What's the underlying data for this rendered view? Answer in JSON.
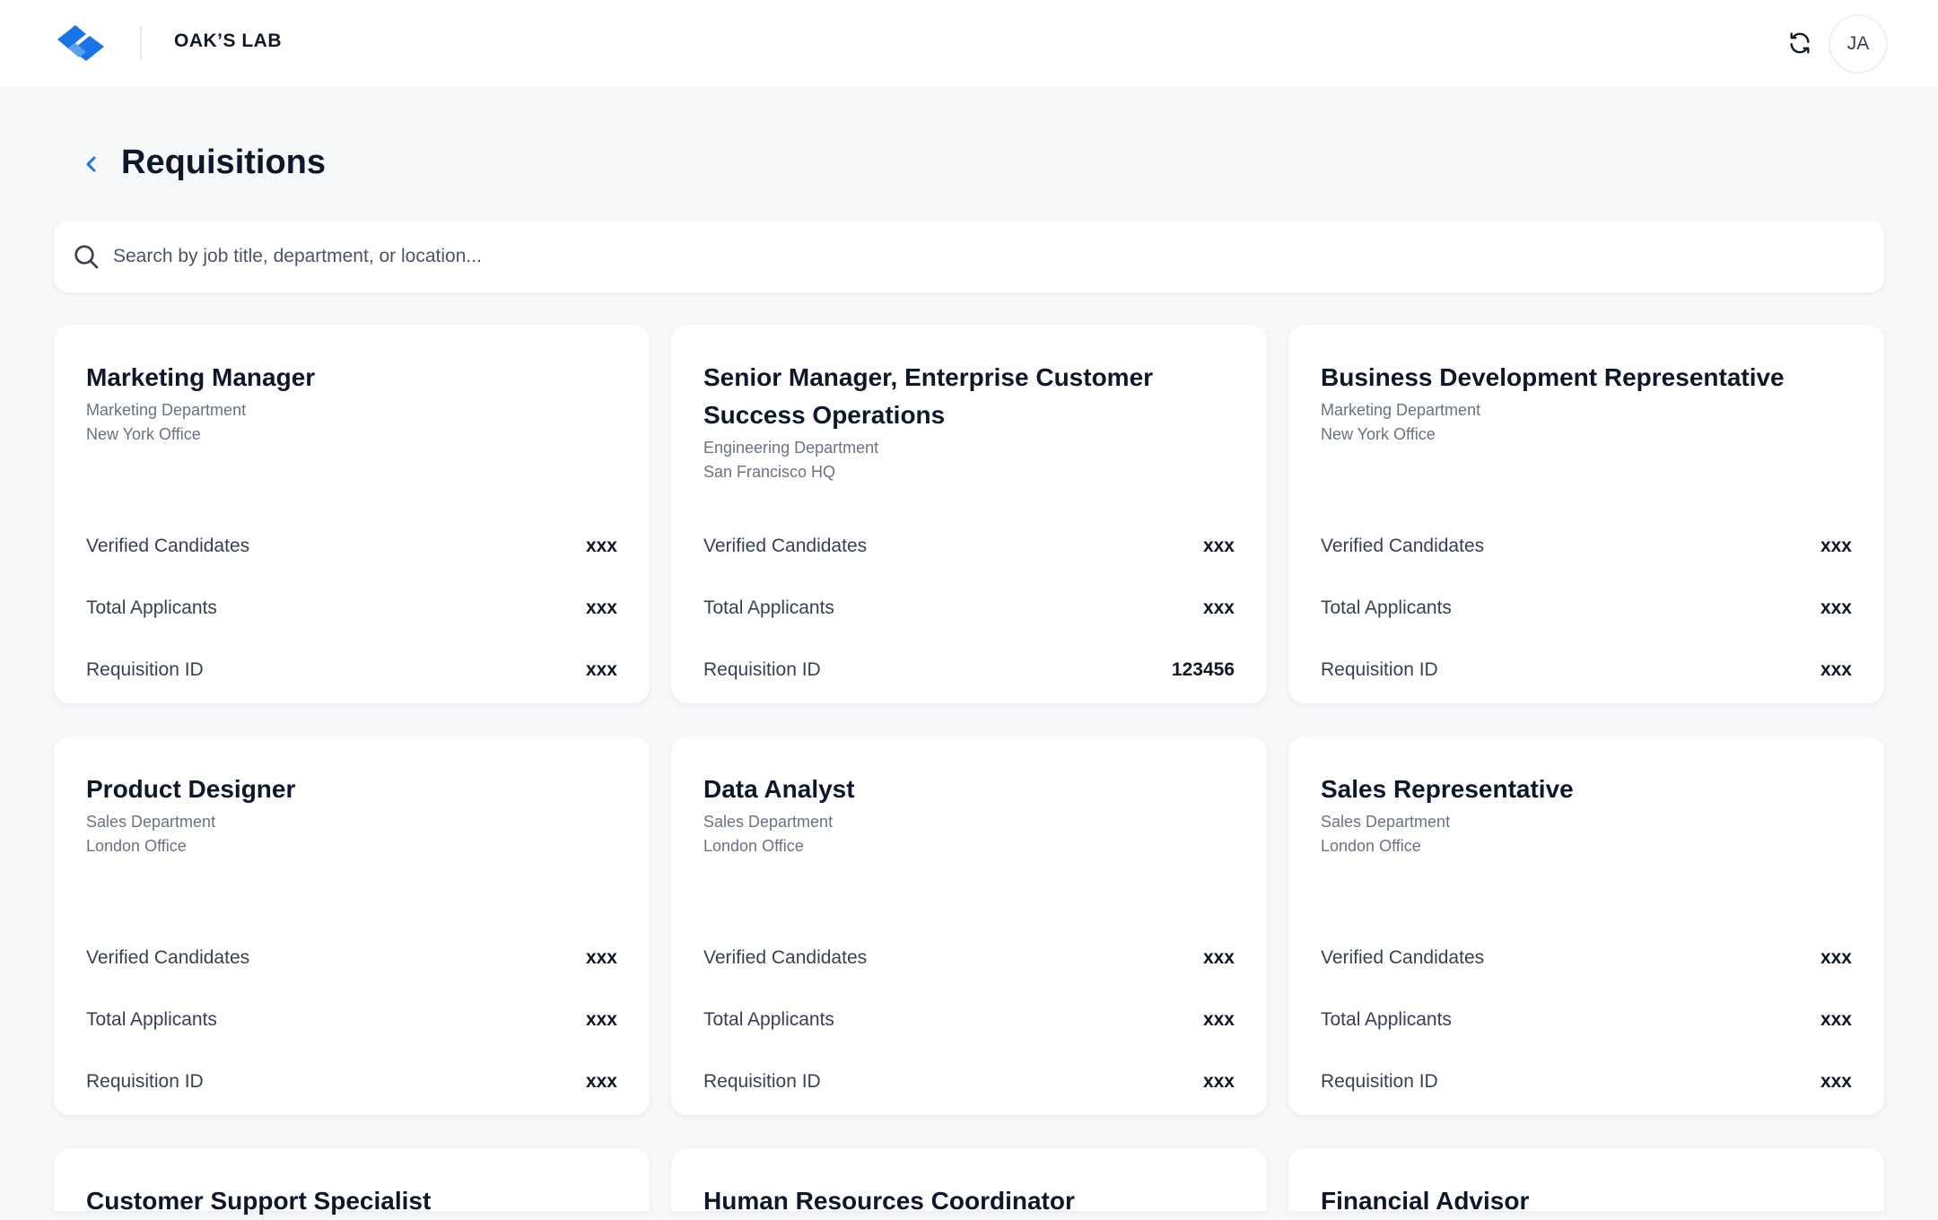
{
  "header": {
    "org_name": "OAK’S LAB",
    "avatar_initials": "JA",
    "icons": {
      "logo": "logo-mark",
      "refresh": "refresh-icon"
    },
    "brand_color": "#1a73e8"
  },
  "page": {
    "title": "Requisitions"
  },
  "search": {
    "placeholder": "Search by job title, department, or location..."
  },
  "labels": {
    "verified": "Verified Candidates",
    "total": "Total Applicants",
    "req_id": "Requisition ID"
  },
  "cards": [
    {
      "title": "Marketing Manager",
      "department": "Marketing Department",
      "location": "New York Office",
      "verified": "xxx",
      "total": "xxx",
      "req_id": "xxx"
    },
    {
      "title": "Senior Manager, Enterprise Customer Success Operations",
      "department": "Engineering Department",
      "location": "San Francisco HQ",
      "verified": "xxx",
      "total": "xxx",
      "req_id": "123456"
    },
    {
      "title": "Business Development Representative",
      "department": "Marketing Department",
      "location": "New York Office",
      "verified": "xxx",
      "total": "xxx",
      "req_id": "xxx"
    },
    {
      "title": "Product Designer",
      "department": "Sales Department",
      "location": "London Office",
      "verified": "xxx",
      "total": "xxx",
      "req_id": "xxx"
    },
    {
      "title": "Data Analyst",
      "department": "Sales Department",
      "location": "London Office",
      "verified": "xxx",
      "total": "xxx",
      "req_id": "xxx"
    },
    {
      "title": "Sales Representative",
      "department": "Sales Department",
      "location": "London Office",
      "verified": "xxx",
      "total": "xxx",
      "req_id": "xxx"
    },
    {
      "title": "Customer Support Specialist"
    },
    {
      "title": "Human Resources Coordinator"
    },
    {
      "title": "Financial Advisor"
    }
  ]
}
